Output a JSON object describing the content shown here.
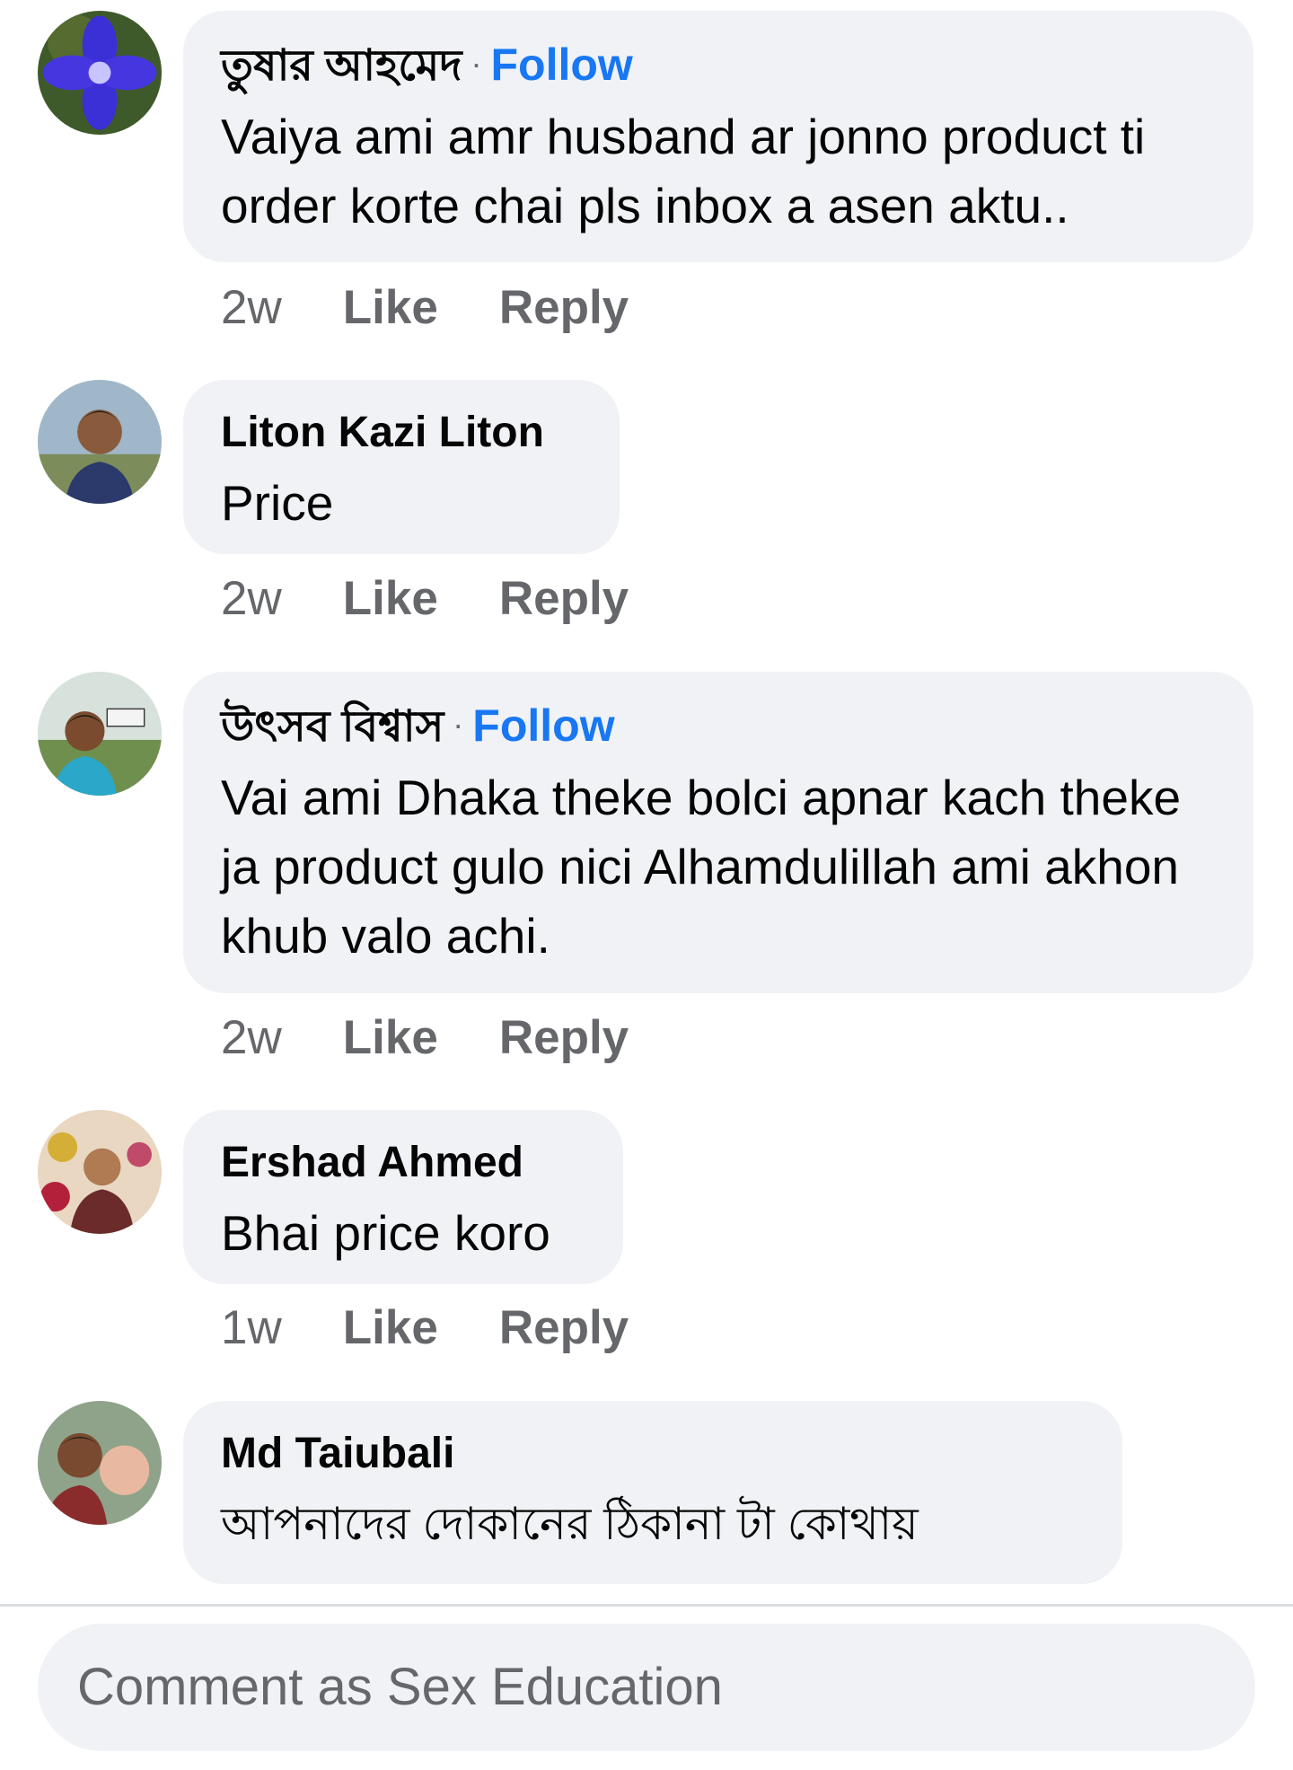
{
  "comments": [
    {
      "author": "তুষার আহমেদ",
      "follow": "Follow",
      "text": "Vaiya ami amr husband ar jonno product ti order korte chai pls inbox a asen aktu..",
      "time": "2w",
      "like": "Like",
      "reply": "Reply"
    },
    {
      "author": "Liton Kazi Liton",
      "text": "Price",
      "time": "2w",
      "like": "Like",
      "reply": "Reply"
    },
    {
      "author": "উৎসব বিশ্বাস",
      "follow": "Follow",
      "text": "Vai ami Dhaka theke bolci apnar kach theke ja product gulo nici Alhamdulillah ami akhon khub valo achi.",
      "time": "2w",
      "like": "Like",
      "reply": "Reply"
    },
    {
      "author": "Ershad Ahmed",
      "text": "Bhai price koro",
      "time": "1w",
      "like": "Like",
      "reply": "Reply"
    },
    {
      "author": "Md Taiubali",
      "text": "আপনাদের দোকানের ঠিকানা টা কোথায়"
    }
  ],
  "composer": {
    "placeholder": "Comment as Sex Education"
  },
  "colors": {
    "link": "#1877f2",
    "bubble": "#f0f2f5",
    "meta": "#65676b"
  }
}
